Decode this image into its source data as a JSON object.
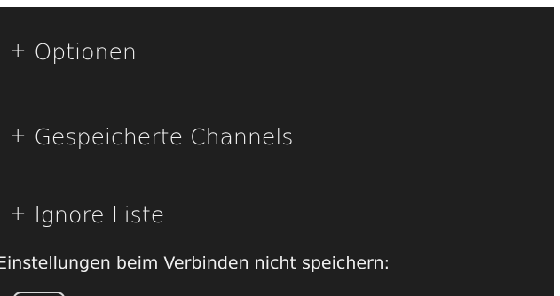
{
  "sections": [
    {
      "expander_glyph": "+",
      "label": "Optionen"
    },
    {
      "expander_glyph": "+",
      "label": "Gespeicherte Channels"
    },
    {
      "expander_glyph": "+",
      "label": "Ignore Liste"
    }
  ],
  "settings": {
    "dont_save_on_connect_label": "Einstellungen beim Verbinden nicht speichern:"
  },
  "colors": {
    "panel_background": "#1f1f1f",
    "page_background": "#ffffff",
    "text": "#f2f2f2"
  }
}
